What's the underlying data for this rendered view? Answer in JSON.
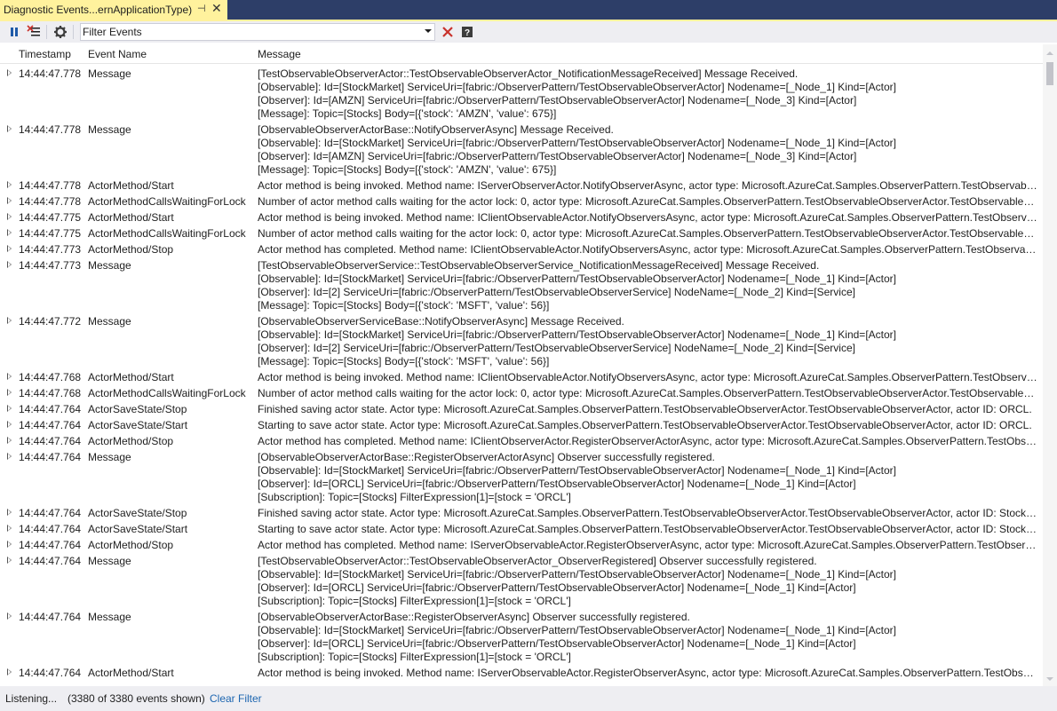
{
  "tab": {
    "title": "Diagnostic Events...ernApplicationType)",
    "pin_icon": "pin-icon",
    "close_icon": "close-icon"
  },
  "toolbar": {
    "pause_icon": "pause-icon",
    "clear_icon": "clear-events-icon",
    "settings_icon": "gear-icon",
    "filter_placeholder": "Filter Events",
    "filter_value": "Filter Events",
    "clear_filter_icon": "red-x-icon",
    "help_icon": "help-icon"
  },
  "columns": [
    "Timestamp",
    "Event Name",
    "Message"
  ],
  "rows": [
    {
      "ts": "14:44:47.778",
      "ev": "Message",
      "msg": [
        "[TestObservableObserverActor::TestObservableObserverActor_NotificationMessageReceived] Message Received.",
        "[Observable]: Id=[StockMarket] ServiceUri=[fabric:/ObserverPattern/TestObservableObserverActor] Nodename=[_Node_1] Kind=[Actor]",
        "[Observer]: Id=[AMZN] ServiceUri=[fabric:/ObserverPattern/TestObservableObserverActor] Nodename=[_Node_3] Kind=[Actor]",
        "[Message]: Topic=[Stocks] Body=[{'stock': 'AMZN', 'value': 675}]"
      ]
    },
    {
      "ts": "14:44:47.778",
      "ev": "Message",
      "msg": [
        "[ObservableObserverActorBase::NotifyObserverAsync] Message Received.",
        "[Observable]: Id=[StockMarket] ServiceUri=[fabric:/ObserverPattern/TestObservableObserverActor] Nodename=[_Node_1] Kind=[Actor]",
        "[Observer]: Id=[AMZN] ServiceUri=[fabric:/ObserverPattern/TestObservableObserverActor] Nodename=[_Node_3] Kind=[Actor]",
        "[Message]: Topic=[Stocks] Body=[{'stock': 'AMZN', 'value': 675}]"
      ]
    },
    {
      "ts": "14:44:47.778",
      "ev": "ActorMethod/Start",
      "msg": [
        "Actor method is being invoked. Method name: IServerObserverActor.NotifyObserverAsync, actor type: Microsoft.AzureCat.Samples.ObserverPattern.TestObservableO..."
      ]
    },
    {
      "ts": "14:44:47.778",
      "ev": "ActorMethodCallsWaitingForLock",
      "msg": [
        "Number of actor method calls waiting for the actor lock: 0, actor type: Microsoft.AzureCat.Samples.ObserverPattern.TestObservableObserverActor.TestObservableObs..."
      ]
    },
    {
      "ts": "14:44:47.775",
      "ev": "ActorMethod/Start",
      "msg": [
        "Actor method is being invoked. Method name: IClientObservableActor.NotifyObserversAsync, actor type: Microsoft.AzureCat.Samples.ObserverPattern.TestObservabl..."
      ]
    },
    {
      "ts": "14:44:47.775",
      "ev": "ActorMethodCallsWaitingForLock",
      "msg": [
        "Number of actor method calls waiting for the actor lock: 0, actor type: Microsoft.AzureCat.Samples.ObserverPattern.TestObservableObserverActor.TestObservableObs..."
      ]
    },
    {
      "ts": "14:44:47.773",
      "ev": "ActorMethod/Stop",
      "msg": [
        "Actor method has completed. Method name: IClientObservableActor.NotifyObserversAsync, actor type: Microsoft.AzureCat.Samples.ObserverPattern.TestObservable..."
      ]
    },
    {
      "ts": "14:44:47.773",
      "ev": "Message",
      "msg": [
        "[TestObservableObserverService::TestObservableObserverService_NotificationMessageReceived] Message Received.",
        "[Observable]: Id=[StockMarket] ServiceUri=[fabric:/ObserverPattern/TestObservableObserverActor] Nodename=[_Node_1] Kind=[Actor]",
        "[Observer]: Id=[2] ServiceUri=[fabric:/ObserverPattern/TestObservableObserverService] NodeName=[_Node_2] Kind=[Service]",
        "[Message]: Topic=[Stocks] Body=[{'stock': 'MSFT', 'value': 56}]"
      ]
    },
    {
      "ts": "14:44:47.772",
      "ev": "Message",
      "msg": [
        "[ObservableObserverServiceBase::NotifyObserverAsync] Message Received.",
        "[Observable]: Id=[StockMarket] ServiceUri=[fabric:/ObserverPattern/TestObservableObserverActor] Nodename=[_Node_1] Kind=[Actor]",
        "[Observer]: Id=[2] ServiceUri=[fabric:/ObserverPattern/TestObservableObserverService] NodeName=[_Node_2] Kind=[Service]",
        "[Message]: Topic=[Stocks] Body=[{'stock': 'MSFT', 'value': 56}]"
      ]
    },
    {
      "ts": "14:44:47.768",
      "ev": "ActorMethod/Start",
      "msg": [
        "Actor method is being invoked. Method name: IClientObservableActor.NotifyObserversAsync, actor type: Microsoft.AzureCat.Samples.ObserverPattern.TestObservabl..."
      ]
    },
    {
      "ts": "14:44:47.768",
      "ev": "ActorMethodCallsWaitingForLock",
      "msg": [
        "Number of actor method calls waiting for the actor lock: 0, actor type: Microsoft.AzureCat.Samples.ObserverPattern.TestObservableObserverActor.TestObservableObs..."
      ]
    },
    {
      "ts": "14:44:47.764",
      "ev": "ActorSaveState/Stop",
      "msg": [
        "Finished saving actor state. Actor type: Microsoft.AzureCat.Samples.ObserverPattern.TestObservableObserverActor.TestObservableObserverActor, actor ID: ORCL."
      ]
    },
    {
      "ts": "14:44:47.764",
      "ev": "ActorSaveState/Start",
      "msg": [
        "Starting to save actor state. Actor type: Microsoft.AzureCat.Samples.ObserverPattern.TestObservableObserverActor.TestObservableObserverActor, actor ID: ORCL."
      ]
    },
    {
      "ts": "14:44:47.764",
      "ev": "ActorMethod/Stop",
      "msg": [
        "Actor method has completed. Method name: IClientObserverActor.RegisterObserverActorAsync, actor type: Microsoft.AzureCat.Samples.ObserverPattern.TestObserv..."
      ]
    },
    {
      "ts": "14:44:47.764",
      "ev": "Message",
      "msg": [
        "[ObservableObserverActorBase::RegisterObserverActorAsync] Observer successfully registered.",
        "[Observable]: Id=[StockMarket] ServiceUri=[fabric:/ObserverPattern/TestObservableObserverActor] Nodename=[_Node_1] Kind=[Actor]",
        "[Observer]: Id=[ORCL] ServiceUri=[fabric:/ObserverPattern/TestObservableObserverActor] Nodename=[_Node_1] Kind=[Actor]",
        "[Subscription]: Topic=[Stocks] FilterExpression[1]=[stock = 'ORCL']"
      ]
    },
    {
      "ts": "14:44:47.764",
      "ev": "ActorSaveState/Stop",
      "msg": [
        "Finished saving actor state. Actor type: Microsoft.AzureCat.Samples.ObserverPattern.TestObservableObserverActor.TestObservableObserverActor, actor ID: StockMark..."
      ]
    },
    {
      "ts": "14:44:47.764",
      "ev": "ActorSaveState/Start",
      "msg": [
        "Starting to save actor state. Actor type: Microsoft.AzureCat.Samples.ObserverPattern.TestObservableObserverActor.TestObservableObserverActor, actor ID: StockMark..."
      ]
    },
    {
      "ts": "14:44:47.764",
      "ev": "ActorMethod/Stop",
      "msg": [
        "Actor method has completed. Method name: IServerObservableActor.RegisterObserverAsync, actor type: Microsoft.AzureCat.Samples.ObserverPattern.TestObservabl..."
      ]
    },
    {
      "ts": "14:44:47.764",
      "ev": "Message",
      "msg": [
        "[TestObservableObserverActor::TestObservableObserverActor_ObserverRegistered] Observer successfully registered.",
        "[Observable]: Id=[StockMarket] ServiceUri=[fabric:/ObserverPattern/TestObservableObserverActor] Nodename=[_Node_1] Kind=[Actor]",
        "[Observer]: Id=[ORCL] ServiceUri=[fabric:/ObserverPattern/TestObservableObserverActor] Nodename=[_Node_1] Kind=[Actor]",
        "[Subscription]: Topic=[Stocks] FilterExpression[1]=[stock = 'ORCL']"
      ]
    },
    {
      "ts": "14:44:47.764",
      "ev": "Message",
      "msg": [
        "[ObservableObserverActorBase::RegisterObserverAsync] Observer successfully registered.",
        "[Observable]: Id=[StockMarket] ServiceUri=[fabric:/ObserverPattern/TestObservableObserverActor] Nodename=[_Node_1] Kind=[Actor]",
        "[Observer]: Id=[ORCL] ServiceUri=[fabric:/ObserverPattern/TestObservableObserverActor] Nodename=[_Node_1] Kind=[Actor]",
        "[Subscription]: Topic=[Stocks] FilterExpression[1]=[stock = 'ORCL']"
      ]
    },
    {
      "ts": "14:44:47.764",
      "ev": "ActorMethod/Start",
      "msg": [
        "Actor method is being invoked. Method name: IServerObservableActor.RegisterObserverAsync, actor type: Microsoft.AzureCat.Samples.ObserverPattern.TestObservab..."
      ]
    }
  ],
  "status": {
    "state": "Listening...",
    "count": "(3380 of 3380 events shown)",
    "clear_filter": "Clear Filter"
  },
  "colors": {
    "tab_active": "#fff29d",
    "tab_strip": "#2d3e68",
    "toolbar_bg": "#eeeef2",
    "link": "#1c65b0",
    "clear_x": "#c8312b"
  }
}
